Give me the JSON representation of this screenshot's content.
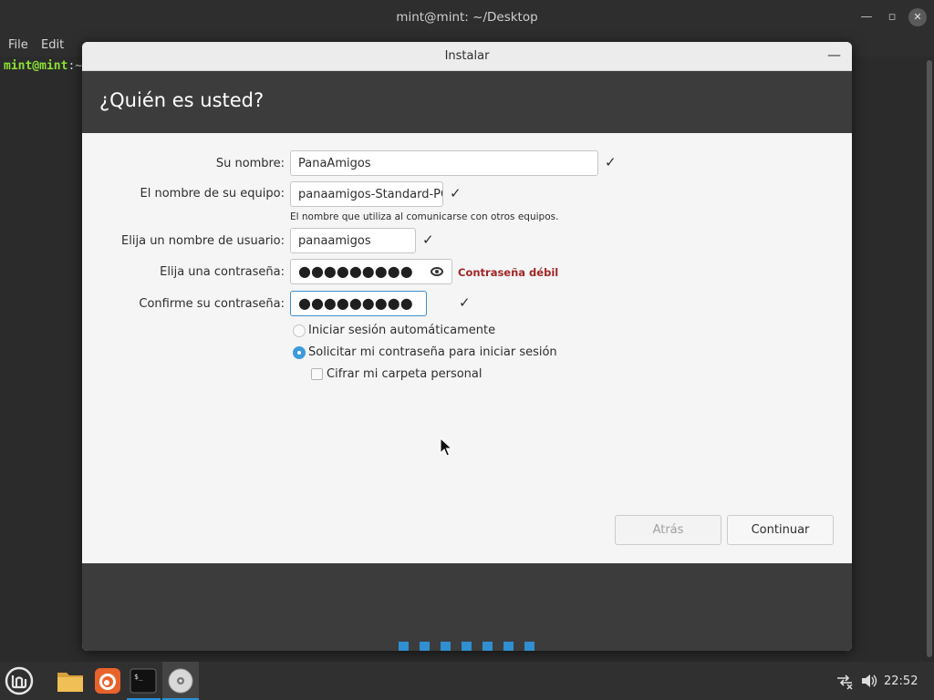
{
  "terminal": {
    "title": "mint@mint: ~/Desktop",
    "menu": [
      "File",
      "Edit"
    ],
    "prompt_user": "mint@mint",
    "prompt_tail": ":~"
  },
  "installer": {
    "window_title": "Instalar",
    "heading": "¿Quién es usted?",
    "fields": {
      "name_label": "Su nombre:",
      "name_value": "PanaAmigos",
      "computer_label": "El nombre de su equipo:",
      "computer_value": "panaamigos-Standard-PC",
      "computer_hint": "El nombre que utiliza al comunicarse con otros equipos.",
      "username_label": "Elija un nombre de usuario:",
      "username_value": "panaamigos",
      "password_label": "Elija una contraseña:",
      "password_mask": "●●●●●●●●●",
      "password_strength": "Contraseña débil",
      "confirm_label": "Confirme su contraseña:",
      "confirm_mask": "●●●●●●●●●"
    },
    "validation_mark": "✓",
    "options": {
      "auto_login": "Iniciar sesión automáticamente",
      "require_password": "Solicitar mi contraseña para iniciar sesión",
      "encrypt_home": "Cifrar mi carpeta personal",
      "auto_login_selected": false,
      "require_password_selected": true,
      "encrypt_home_checked": false
    },
    "buttons": {
      "back": "Atrás",
      "continue": "Continuar"
    },
    "progress": {
      "total_steps": 7
    }
  },
  "taskbar": {
    "clock": "22:52",
    "apps": [
      "menu-icon",
      "files-icon",
      "firefox-icon",
      "terminal-icon",
      "installer-disc-icon"
    ]
  },
  "colors": {
    "accent": "#2f8fd0",
    "header_bg": "#3c3c3c",
    "warning_text": "#a12828",
    "prompt_green": "#8ae234"
  }
}
